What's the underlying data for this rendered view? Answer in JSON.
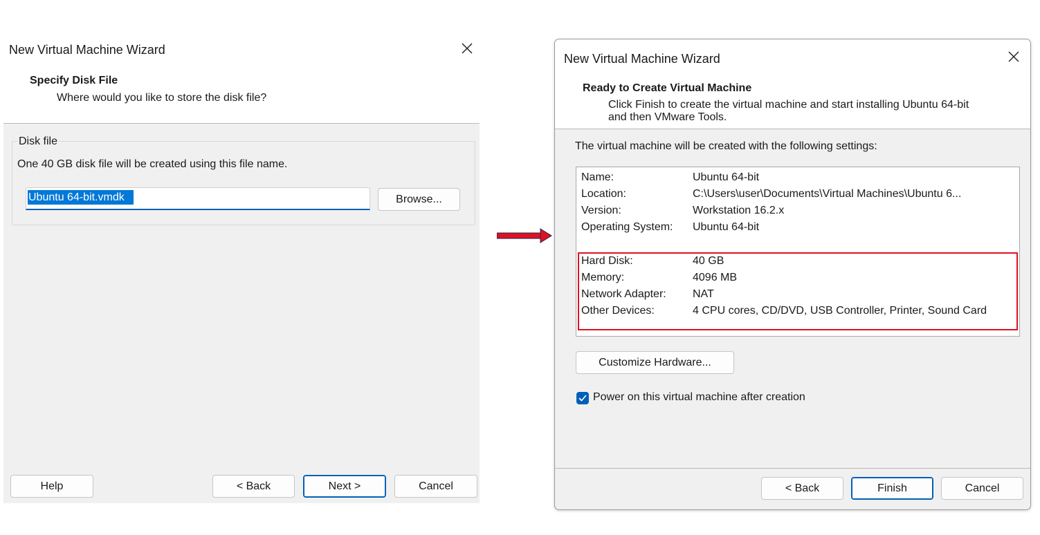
{
  "left_dialog": {
    "title": "New Virtual Machine Wizard",
    "header_title": "Specify Disk File",
    "header_subtitle": "Where would you like to store the disk file?",
    "group_label": "Disk file",
    "description": "One 40 GB disk file will be created using this file name.",
    "file_name_value": "Ubuntu 64-bit.vmdk",
    "browse_label": "Browse...",
    "help_label": "Help",
    "back_label": "< Back",
    "next_label": "Next >",
    "cancel_label": "Cancel"
  },
  "right_dialog": {
    "title": "New Virtual Machine Wizard",
    "header_title": "Ready to Create Virtual Machine",
    "header_subtitle_line1": "Click Finish to create the virtual machine and start installing Ubuntu 64-bit",
    "header_subtitle_line2": "and then VMware Tools.",
    "intro": "The virtual machine will be created with the following settings:",
    "settings_basic": [
      {
        "key": "Name:",
        "value": "Ubuntu 64-bit"
      },
      {
        "key": "Location:",
        "value": "C:\\Users\\user\\Documents\\Virtual Machines\\Ubuntu 6..."
      },
      {
        "key": "Version:",
        "value": "Workstation 16.2.x"
      },
      {
        "key": "Operating System:",
        "value": "Ubuntu 64-bit"
      }
    ],
    "settings_hardware": [
      {
        "key": "Hard Disk:",
        "value": "40 GB"
      },
      {
        "key": "Memory:",
        "value": "4096 MB"
      },
      {
        "key": "Network Adapter:",
        "value": "NAT"
      },
      {
        "key": "Other Devices:",
        "value": "4 CPU cores, CD/DVD, USB Controller, Printer, Sound Card"
      }
    ],
    "customize_label": "Customize Hardware...",
    "power_on_label": "Power on this virtual machine after creation",
    "power_on_checked": true,
    "back_label": "< Back",
    "finish_label": "Finish",
    "cancel_label": "Cancel"
  },
  "annotations": {
    "arrow_color": "#e01020",
    "highlight_color": "#e01020"
  },
  "colors": {
    "accent": "#005fb8",
    "selection": "#0078d7",
    "dialog_bg": "#f0f0f0"
  }
}
